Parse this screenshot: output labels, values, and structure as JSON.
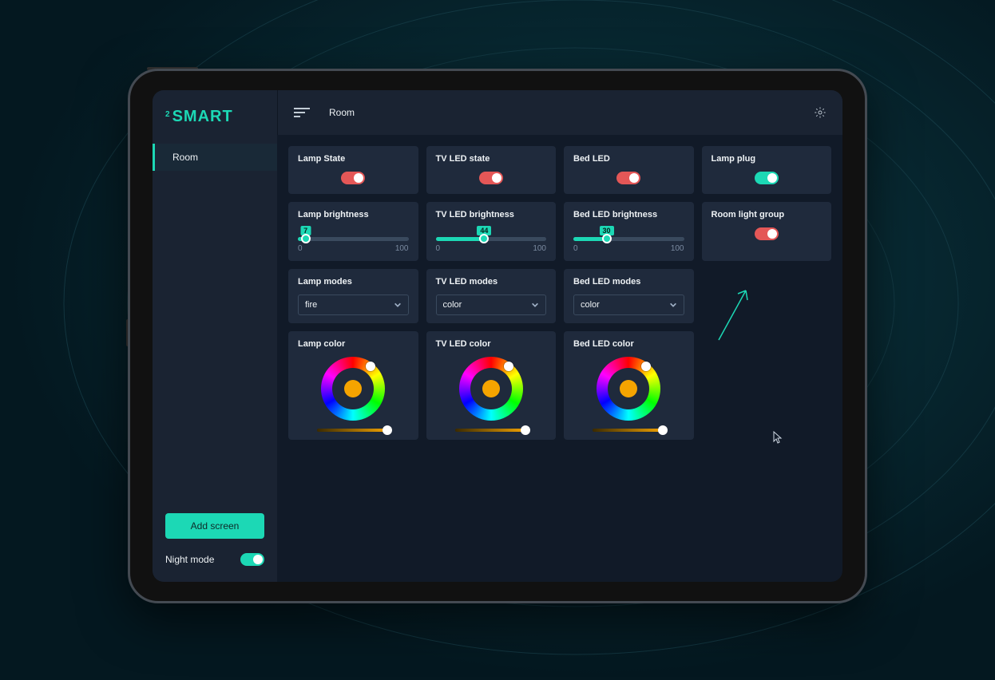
{
  "logo": {
    "prefix": "2",
    "name": "SMART"
  },
  "header": {
    "title": "Room"
  },
  "sidebar": {
    "items": [
      {
        "label": "Room"
      }
    ],
    "add_screen_label": "Add screen",
    "night_mode_label": "Night mode",
    "night_mode_on": true
  },
  "cards": {
    "toggles": [
      {
        "title": "Lamp State",
        "state": "red-on"
      },
      {
        "title": "TV LED state",
        "state": "red-on"
      },
      {
        "title": "Bed LED",
        "state": "red-on"
      },
      {
        "title": "Lamp plug",
        "state": "on"
      }
    ],
    "sliders": [
      {
        "title": "Lamp brightness",
        "value": 7,
        "min": 0,
        "max": 100
      },
      {
        "title": "TV LED brightness",
        "value": 44,
        "min": 0,
        "max": 100
      },
      {
        "title": "Bed LED brightness",
        "value": 30,
        "min": 0,
        "max": 100
      }
    ],
    "group_toggle": {
      "title": "Room light group",
      "state": "red-on"
    },
    "modes": [
      {
        "title": "Lamp modes",
        "selected": "fire"
      },
      {
        "title": "TV LED modes",
        "selected": "color"
      },
      {
        "title": "Bed LED modes",
        "selected": "color"
      }
    ],
    "colors": [
      {
        "title": "Lamp color"
      },
      {
        "title": "TV LED color"
      },
      {
        "title": "Bed LED color"
      }
    ]
  }
}
